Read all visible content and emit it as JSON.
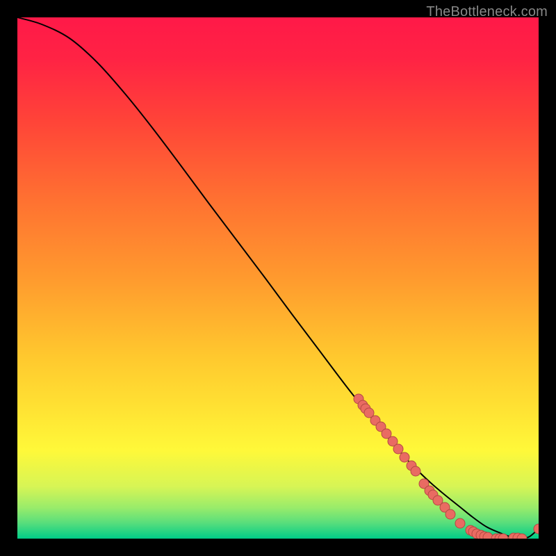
{
  "attribution": "TheBottleneck.com",
  "chart_data": {
    "type": "line",
    "title": "",
    "xlabel": "",
    "ylabel": "",
    "xlim": [
      25,
      775
    ],
    "ylim": [
      775,
      25
    ],
    "grid": false,
    "legend": false,
    "background_gradient": {
      "orientation": "vertical",
      "stops": [
        {
          "offset": 0.0,
          "color": "#ff1948"
        },
        {
          "offset": 0.08,
          "color": "#ff2344"
        },
        {
          "offset": 0.2,
          "color": "#ff4438"
        },
        {
          "offset": 0.35,
          "color": "#ff7131"
        },
        {
          "offset": 0.5,
          "color": "#ff9a2e"
        },
        {
          "offset": 0.65,
          "color": "#ffc82e"
        },
        {
          "offset": 0.75,
          "color": "#ffe233"
        },
        {
          "offset": 0.83,
          "color": "#fff839"
        },
        {
          "offset": 0.9,
          "color": "#d7f555"
        },
        {
          "offset": 0.94,
          "color": "#9aec6a"
        },
        {
          "offset": 0.97,
          "color": "#58de7c"
        },
        {
          "offset": 1.0,
          "color": "#00cc88"
        }
      ]
    },
    "series": [
      {
        "name": "bottleneck-curve",
        "x": [
          25,
          60,
          100,
          140,
          180,
          220,
          260,
          300,
          340,
          380,
          420,
          460,
          500,
          540,
          580,
          600,
          620,
          640,
          660,
          680,
          700,
          720,
          740,
          752,
          762,
          775
        ],
        "y": [
          25,
          35,
          55,
          90,
          135,
          185,
          238,
          292,
          345,
          398,
          452,
          505,
          558,
          608,
          655,
          676,
          695,
          712,
          728,
          744,
          758,
          767,
          774,
          775,
          772,
          761
        ],
        "stroke": "#000000",
        "stroke_width": 2
      }
    ],
    "scatter_points": {
      "name": "data-points",
      "fill": "#e96b62",
      "stroke": "#b34a42",
      "r": 7,
      "points": [
        {
          "x": 516,
          "y": 574
        },
        {
          "x": 522,
          "y": 583
        },
        {
          "x": 526,
          "y": 588
        },
        {
          "x": 531,
          "y": 594
        },
        {
          "x": 540,
          "y": 605
        },
        {
          "x": 548,
          "y": 614
        },
        {
          "x": 556,
          "y": 624
        },
        {
          "x": 565,
          "y": 635
        },
        {
          "x": 573,
          "y": 646
        },
        {
          "x": 582,
          "y": 658
        },
        {
          "x": 592,
          "y": 670
        },
        {
          "x": 598,
          "y": 678
        },
        {
          "x": 610,
          "y": 696
        },
        {
          "x": 618,
          "y": 706
        },
        {
          "x": 623,
          "y": 712
        },
        {
          "x": 630,
          "y": 720
        },
        {
          "x": 640,
          "y": 730
        },
        {
          "x": 648,
          "y": 740
        },
        {
          "x": 662,
          "y": 753
        },
        {
          "x": 677,
          "y": 763
        },
        {
          "x": 681,
          "y": 765
        },
        {
          "x": 686,
          "y": 768
        },
        {
          "x": 692,
          "y": 770
        },
        {
          "x": 697,
          "y": 772
        },
        {
          "x": 702,
          "y": 773
        },
        {
          "x": 714,
          "y": 775
        },
        {
          "x": 719,
          "y": 775
        },
        {
          "x": 724,
          "y": 775
        },
        {
          "x": 739,
          "y": 774
        },
        {
          "x": 745,
          "y": 774
        },
        {
          "x": 751,
          "y": 775
        },
        {
          "x": 775,
          "y": 761
        }
      ]
    }
  }
}
